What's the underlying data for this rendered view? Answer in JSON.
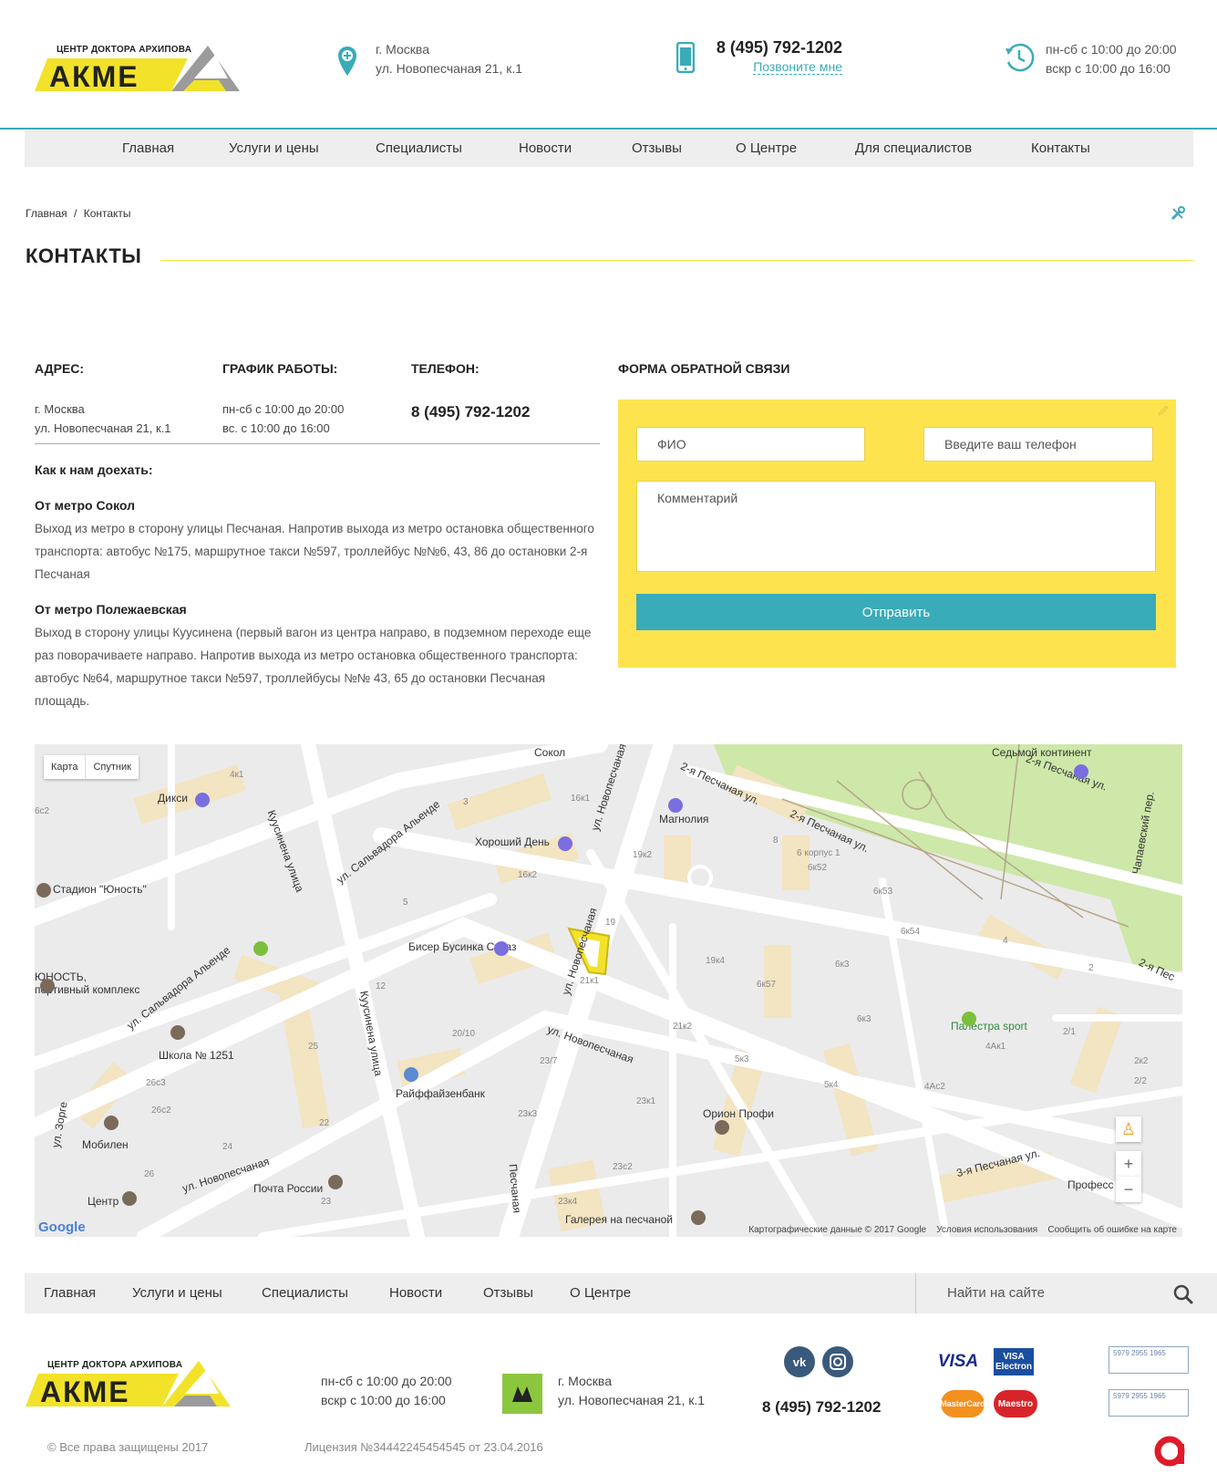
{
  "header": {
    "logo_subtitle": "ЦЕНТР ДОКТОРА АРХИПОВА",
    "logo_word": "АКМЕ",
    "city": "г. Москва",
    "address": "ул. Новопесчаная 21, к.1",
    "phone": "8 (495) 792-1202",
    "call_me": "Позвоните мне",
    "hours_weekday": "пн-сб с 10:00 до 20:00",
    "hours_sunday": "вскр с 10:00 до 16:00"
  },
  "nav": [
    "Главная",
    "Услуги и цены",
    "Специалисты",
    "Новости",
    "Отзывы",
    "О Центре",
    "Для специалистов",
    "Контакты"
  ],
  "breadcrumb": {
    "home": "Главная",
    "separator": "/",
    "current": "Контакты"
  },
  "page_title": "КОНТАКТЫ",
  "contacts": {
    "address_head": "АДРЕС:",
    "address_line1": "г. Москва",
    "address_line2": "ул. Новопесчаная 21, к.1",
    "schedule_head": "ГРАФИК РАБОТЫ:",
    "schedule_line1": "пн-сб с 10:00 до 20:00",
    "schedule_line2": "вс. с 10:00 до 16:00",
    "phone_head": "ТЕЛЕФОН:",
    "phone": "8 (495) 792-1202",
    "how_to_get": "Как к нам доехать:",
    "route1_head": "От метро Сокол",
    "route1_text": "Выход из метро в сторону улицы Песчаная. Напротив выхода из метро остановка общественного транспорта: автобус №175, маршрутное такси №597, троллейбус №№6, 43, 86 до остановки 2-я Песчаная",
    "route2_head": "От метро Полежаевская",
    "route2_text": "Выход в сторону улицы Куусинена (первый вагон из центра направо, в подземном переходе еще раз поворачиваете направо. Напротив выхода из метро остановка общественного транспорта: автобус №64, маршрутное такси №597, троллейбусы №№ 43, 65 до остановки Песчаная площадь."
  },
  "form": {
    "title": "ФОРМА ОБРАТНОЙ СВЯЗИ",
    "name_placeholder": "ФИО",
    "phone_placeholder": "Введите ваш телефон",
    "comment_placeholder": "Комментарий",
    "submit": "Отправить"
  },
  "map": {
    "type_map": "Карта",
    "type_satellite": "Спутник",
    "labels": {
      "sokol": "Сокол",
      "sedmoy": "Седьмой континент",
      "diksi": "Дикси",
      "magnolia": "Магнолия",
      "khoroshiy": "Хороший День",
      "stadion": "Стадион \"Юность\"",
      "biser": "Бисер Бусинка Страз",
      "yunost1": "ЮНОСТЬ,",
      "yunost2": "портивный комплекс",
      "shkola": "Школа № 1251",
      "raiff": "Райффайзенбанк",
      "orion": "Орион Профи",
      "palestra": "Палестра sport",
      "mobilen": "Мобилен",
      "pochta": "Почта России",
      "galereya": "Галерея на песчаной",
      "tsentr": "Центр",
      "profess": "Професс",
      "st_2pes_a": "2-я Песчаная ул.",
      "st_2pes_b": "2-я Песчаная ул.",
      "st_2pes_c": "2-я Песчаная ул.",
      "st_3pes": "3-я Песчаная ул.",
      "st_salv1": "ул. Сальвадора Альенде",
      "st_salv2": "ул. Сальвадора Альенде",
      "st_kuus1": "Куусинена улица",
      "st_kuus2": "Куусинена улица",
      "st_novo1": "ул. Новопесчаная",
      "st_novo2": "ул. Новопесчаная",
      "st_novo3": "ул. Новопесчаная",
      "st_novo4": "ул. Новопесчаная",
      "st_zorge": "ул. Зорге",
      "st_chapaev": "Чапаевский пер.",
      "st_peschanaya": "Песчаная",
      "st_2pe": "2-я Пес"
    },
    "house_numbers": [
      "4к1",
      "16к1",
      "19к2",
      "8",
      "6 корпус 1",
      "6к52",
      "6к53",
      "6к54",
      "3",
      "16к2",
      "5",
      "19",
      "19к4",
      "6к57",
      "6к3",
      "4",
      "12",
      "21к1",
      "21к2",
      "20/10",
      "6к3",
      "5к3",
      "5к4",
      "2/1",
      "2",
      "4Ак1",
      "4Ас2",
      "2к2",
      "2/2",
      "25",
      "26с3",
      "26с2",
      "22",
      "24",
      "26",
      "23/7",
      "23к1",
      "23к3",
      "23с2",
      "23к4",
      "23",
      "6с2"
    ],
    "zoom_in": "+",
    "zoom_out": "−",
    "google": "Google",
    "copyright": "Картографические данные © 2017 Google",
    "terms": "Условия использования",
    "report": "Сообщить об ошибке на карте"
  },
  "footer_nav": [
    "Главная",
    "Услуги и цены",
    "Специалисты",
    "Новости",
    "Отзывы",
    "О Центре"
  ],
  "footer": {
    "search_placeholder": "Найти на сайте",
    "logo_subtitle": "ЦЕНТР ДОКТОРА АРХИПОВА",
    "logo_word": "АКМЕ",
    "hours_weekday": "пн-сб с 10:00 до 20:00",
    "hours_sunday": "вскр с 10:00 до 16:00",
    "city": "г. Москва",
    "address": "ул. Новопесчаная 21, к.1",
    "phone": "8 (495) 792-1202",
    "copyright": "© Все права защищены 2017",
    "license": "Лицензия №34442245454545 от 23.04.2016",
    "visa": "VISA",
    "visa_electron_1": "VISA",
    "visa_electron_2": "Electron",
    "mastercard": "MasterCard",
    "maestro": "Maestro",
    "counter_digits_1": "5979 2955 1965",
    "counter_digits_2": "5979 2955 1965",
    "accell": "accell"
  },
  "colors": {
    "accent_teal": "#3aabb8",
    "form_yellow": "#fde44f",
    "logo_yellow": "#f2e22a",
    "nav_bg": "#eeeeee"
  }
}
